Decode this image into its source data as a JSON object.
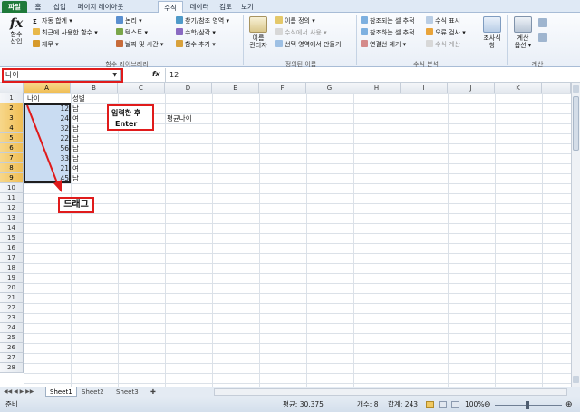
{
  "tabs": [
    "파일",
    "홈",
    "삽입",
    "페이지 레이아웃",
    "수식",
    "데이터",
    "검토",
    "보기"
  ],
  "ribbon": {
    "insert_function": {
      "line1": "함수",
      "line2": "삽입"
    },
    "library": {
      "autosum": "자동 합계 ▾",
      "recent": "최근에 사용한 함수 ▾",
      "finance": "재무 ▾",
      "logical": "논리 ▾",
      "text": "텍스트 ▾",
      "datetime": "날짜 및 시간 ▾",
      "lookup": "찾기/참조 영역 ▾",
      "math": "수학/삼각 ▾",
      "more": "함수 추가 ▾",
      "group_label": "함수 라이브러리"
    },
    "names": {
      "manager_line1": "이름",
      "manager_line2": "관리자",
      "define": "이름 정의 ▾",
      "use_in_formula": "수식에서 사용 ▾",
      "create_from_selection": "선택 영역에서 만들기",
      "group_label": "정의된 이름"
    },
    "auditing": {
      "trace_precedents": "참조되는 셀 추적",
      "trace_dependents": "참조하는 셀 추적",
      "remove_arrows": "연결선 제거 ▾",
      "show_formulas": "수식 표시",
      "error_checking": "오류 검사 ▾",
      "evaluate": "수식 계산",
      "watch_line1": "조사식",
      "watch_line2": "창",
      "group_label": "수식 분석"
    },
    "calculation": {
      "options_line1": "계산",
      "options_line2": "옵션 ▾",
      "group_label": "계산"
    }
  },
  "formula_bar": {
    "name_box": "나이",
    "fx": "fx",
    "value": "12"
  },
  "columns": [
    "A",
    "B",
    "C",
    "D",
    "E",
    "F",
    "G",
    "H",
    "I",
    "J",
    "K"
  ],
  "rows": [
    "1",
    "2",
    "3",
    "4",
    "5",
    "6",
    "7",
    "8",
    "9",
    "10",
    "11",
    "12",
    "13",
    "14",
    "15",
    "16",
    "17",
    "18",
    "19",
    "20",
    "21",
    "22",
    "23",
    "24",
    "25",
    "26",
    "27",
    "28"
  ],
  "cells": {
    "A1": "나이",
    "B1": "성별",
    "A2": "12",
    "B2": "남",
    "A3": "24",
    "B3": "여",
    "A4": "32",
    "B4": "남",
    "A5": "22",
    "B5": "남",
    "A6": "56",
    "B6": "남",
    "A7": "33",
    "B7": "남",
    "A8": "21",
    "B8": "여",
    "A9": "45",
    "B9": "남",
    "D3": "평균나이"
  },
  "callouts": {
    "enter_line1": "입력한 후",
    "enter_line2": "Enter",
    "drag": "드래그"
  },
  "sheet_tabs": [
    "Sheet1",
    "Sheet2",
    "Sheet3"
  ],
  "status": {
    "mode": "준비",
    "average": "평균: 30.375",
    "count": "개수: 8",
    "sum": "합계: 243",
    "zoom": "100%"
  },
  "colors": {
    "accent_red": "#e01b1b",
    "selection": "#c9dcf2",
    "file_tab": "#1f7a3a"
  }
}
